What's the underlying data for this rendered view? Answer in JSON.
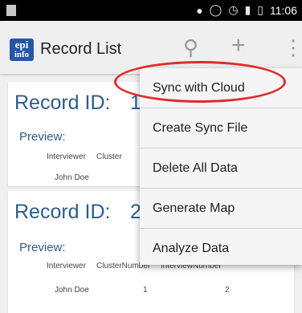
{
  "status_bar": {
    "time": "11:06"
  },
  "action_bar": {
    "logo_line1": "epi",
    "logo_line2": "info",
    "title": "Record List"
  },
  "records": [
    {
      "record_label": "Record ID:",
      "record_id": "1",
      "preview_label": "Preview:",
      "headers": [
        "Interviewer",
        "Cluster"
      ],
      "values": [
        "John Doe"
      ]
    },
    {
      "record_label": "Record ID:",
      "record_id": "2",
      "preview_label": "Preview:",
      "headers": [
        "Interviewer",
        "ClusterNumber",
        "InterviewNumber"
      ],
      "values": [
        "John Doe",
        "1",
        "2"
      ]
    }
  ],
  "menu": {
    "items": [
      "Sync with Cloud",
      "Create Sync File",
      "Delete All Data",
      "Generate Map",
      "Analyze Data"
    ],
    "highlight_color": "#e02b2b"
  }
}
